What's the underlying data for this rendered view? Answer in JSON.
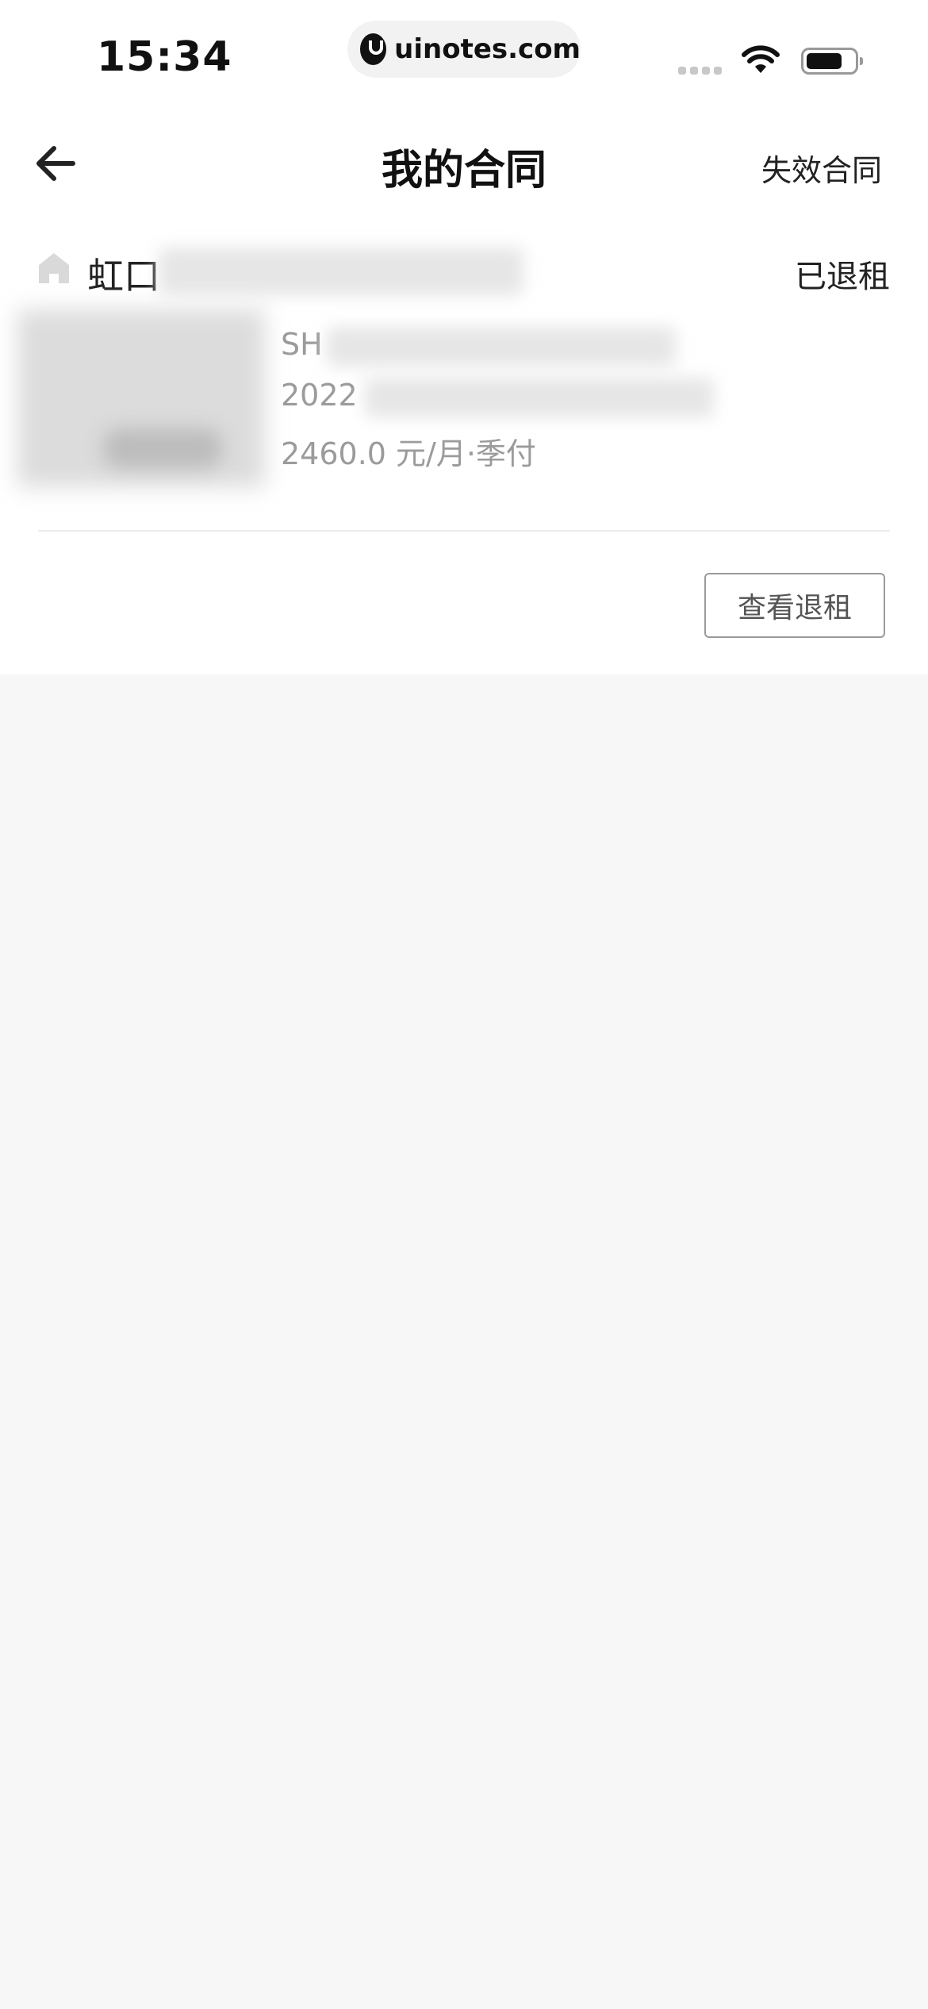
{
  "status_bar": {
    "time": "15:34",
    "url": "uinotes.com"
  },
  "nav": {
    "title": "我的合同",
    "right_action": "失效合同"
  },
  "contract": {
    "district": "虹口",
    "status": "已退租",
    "code": "SH",
    "date": "2022",
    "price": "2460.0 元/月·季付",
    "action_button": "查看退租"
  }
}
